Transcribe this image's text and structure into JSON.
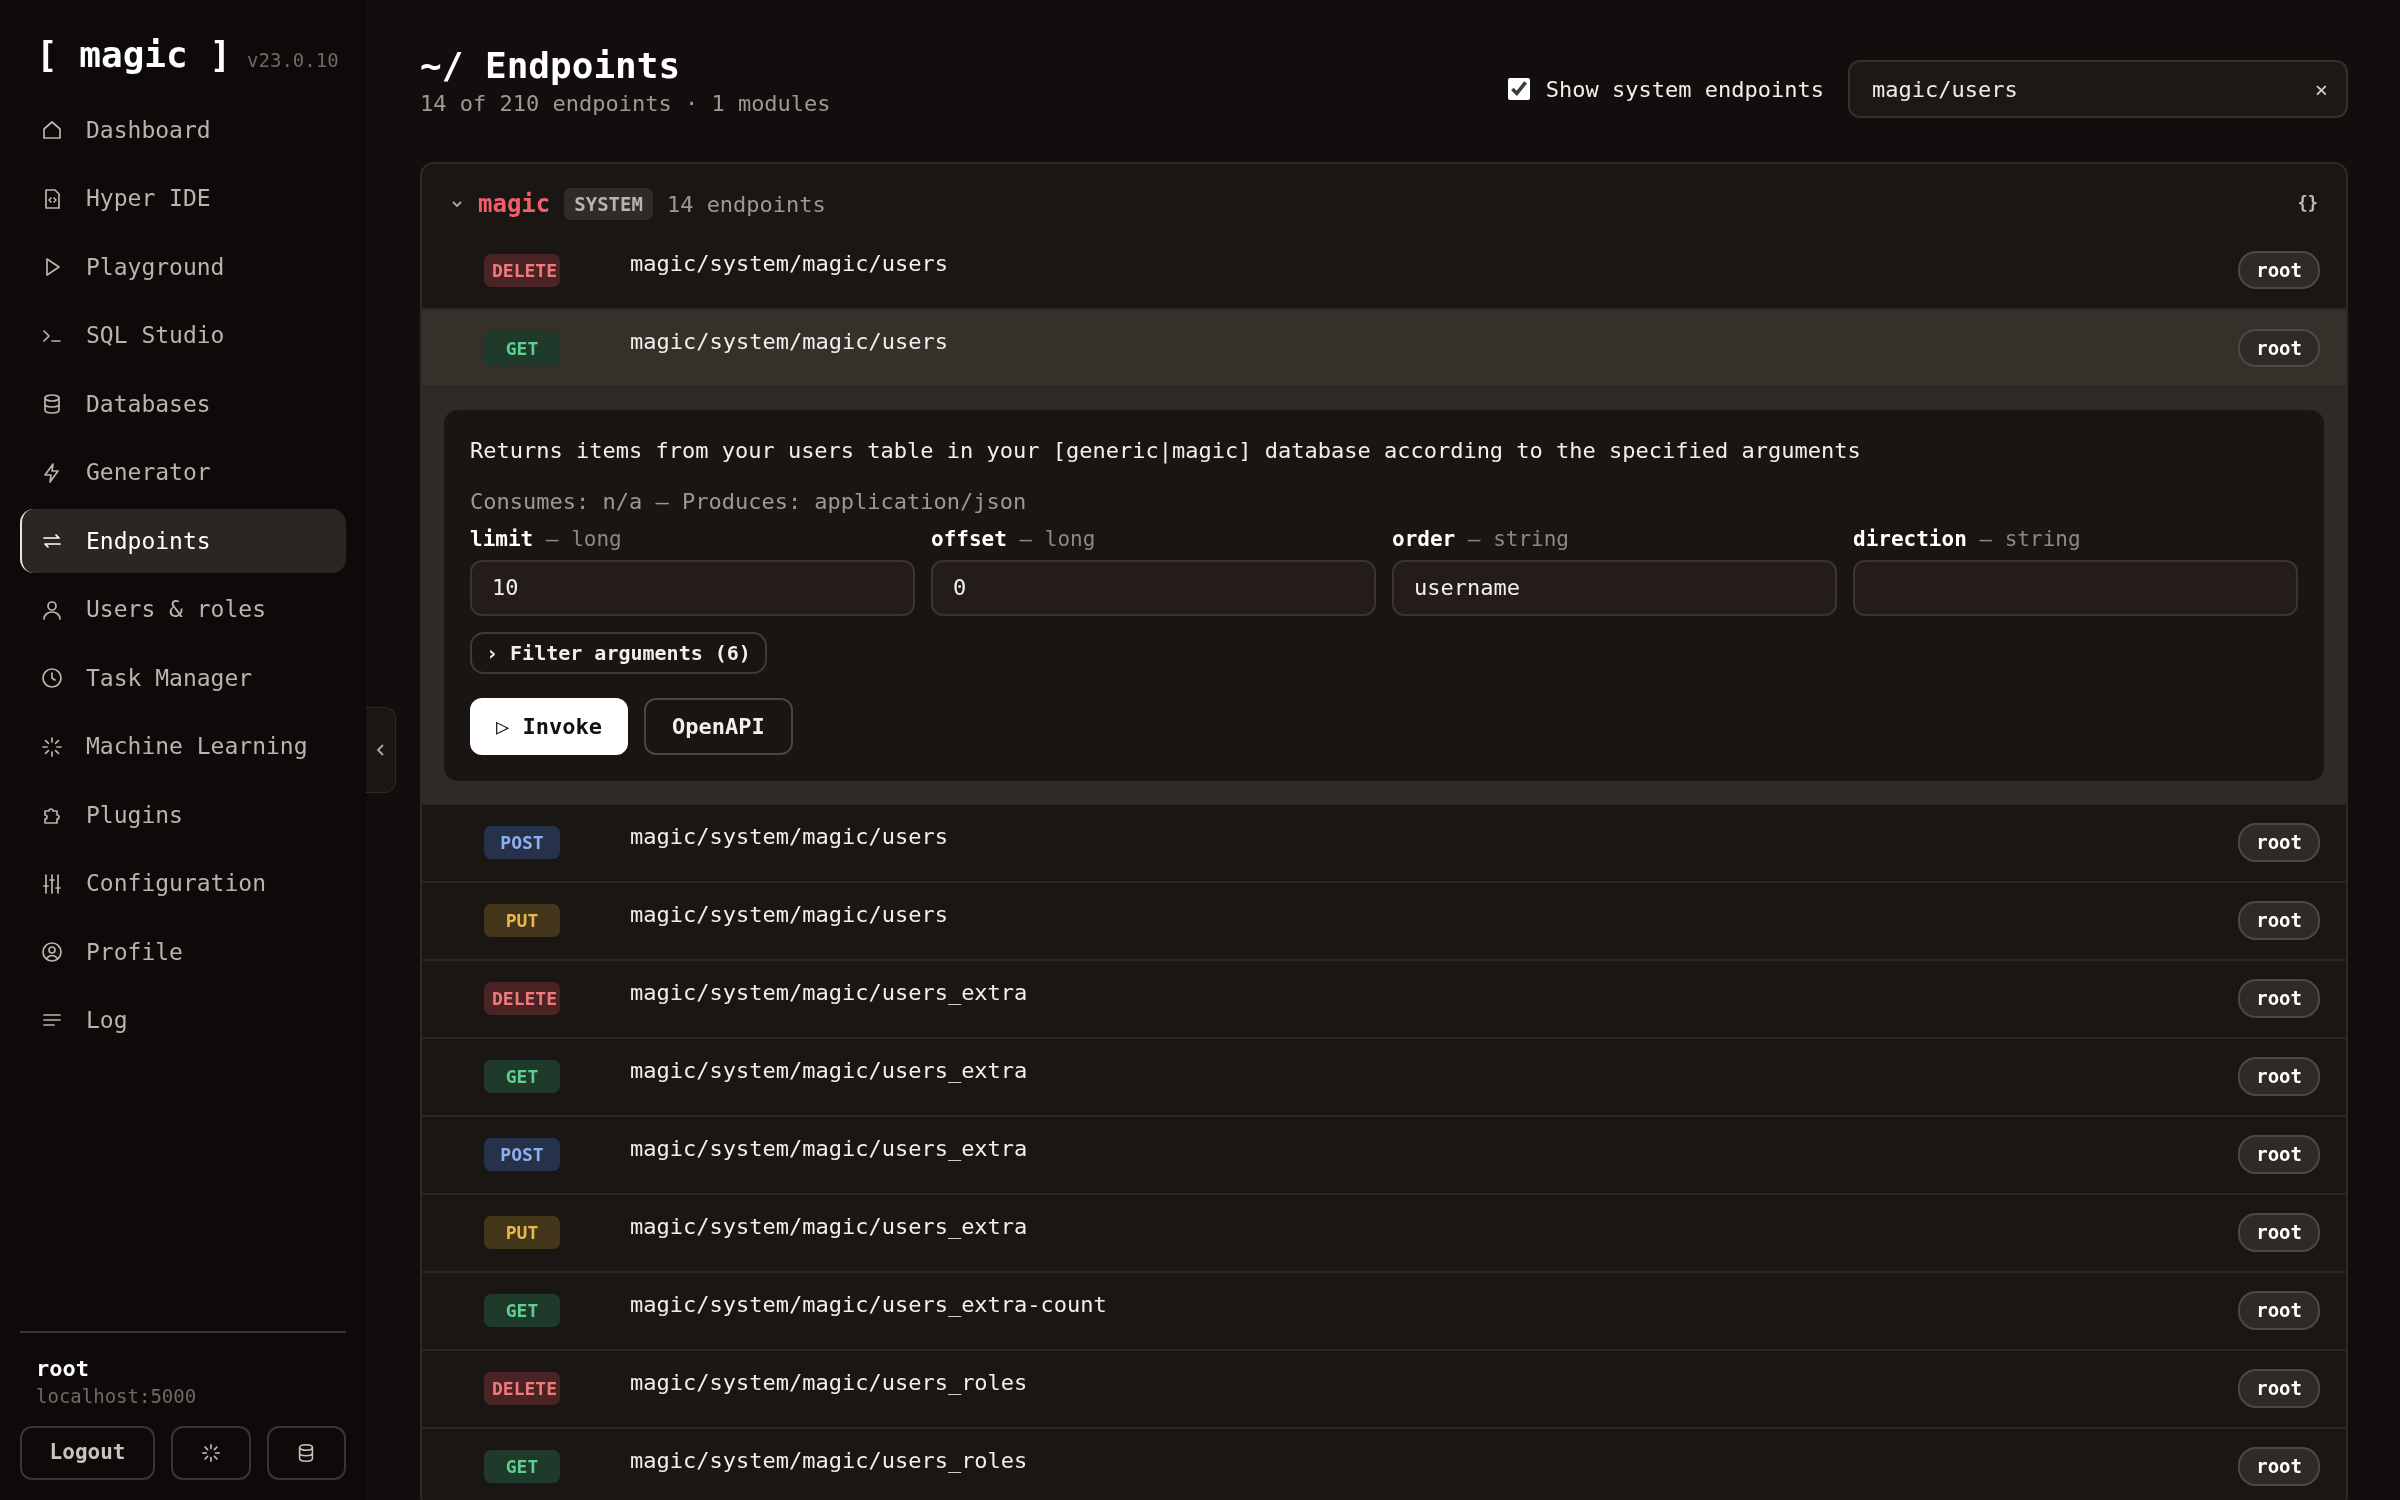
{
  "brand": {
    "logo": "[ magic ]",
    "version": "v23.0.10"
  },
  "sidebar": {
    "items": [
      {
        "label": "Dashboard",
        "selected": false
      },
      {
        "label": "Hyper IDE",
        "selected": false
      },
      {
        "label": "Playground",
        "selected": false
      },
      {
        "label": "SQL Studio",
        "selected": false
      },
      {
        "label": "Databases",
        "selected": false
      },
      {
        "label": "Generator",
        "selected": false
      },
      {
        "label": "Endpoints",
        "selected": true
      },
      {
        "label": "Users & roles",
        "selected": false
      },
      {
        "label": "Task Manager",
        "selected": false
      },
      {
        "label": "Machine Learning",
        "selected": false
      },
      {
        "label": "Plugins",
        "selected": false
      },
      {
        "label": "Configuration",
        "selected": false
      },
      {
        "label": "Profile",
        "selected": false
      },
      {
        "label": "Log",
        "selected": false
      }
    ]
  },
  "user": {
    "name": "root",
    "host": "localhost:5000"
  },
  "footer_buttons": [
    {
      "kind": "text",
      "label": "Logout"
    },
    {
      "kind": "spinner"
    },
    {
      "kind": "database"
    }
  ],
  "page": {
    "title": "~/ Endpoints",
    "subtitle": "14 of 210 endpoints · 1 modules"
  },
  "filters": {
    "show_system": {
      "label": "Show system endpoints",
      "checked": true
    },
    "search": {
      "value": "magic/users",
      "clear": "×"
    }
  },
  "module": {
    "name": "magic",
    "badge": "SYSTEM",
    "count": "14 endpoints",
    "expanded": true,
    "schema_button": "{}",
    "endpoints": [
      {
        "method": "DELETE",
        "kind": "delete",
        "path": "magic/system/magic/users",
        "role": "root",
        "selected": false
      },
      {
        "method": "GET",
        "kind": "get",
        "path": "magic/system/magic/users",
        "role": "root",
        "selected": true,
        "details": {
          "description": "Returns items from your users table in your [generic|magic] database according to the specified arguments",
          "formats": "Consumes: n/a — Produces: application/json",
          "arguments": [
            {
              "name": "limit",
              "type": "— long",
              "value": "10"
            },
            {
              "name": "offset",
              "type": "— long",
              "value": "0"
            },
            {
              "name": "order",
              "type": "— string",
              "value": "username"
            },
            {
              "name": "direction",
              "type": "— string"
            }
          ],
          "filter_toggle": {
            "chevron": "›",
            "label": "Filter arguments (6)"
          },
          "buttons": [
            {
              "kind": "primary",
              "label": "▷ Invoke"
            },
            {
              "kind": "outline",
              "label": "OpenAPI"
            }
          ]
        }
      },
      {
        "method": "POST",
        "kind": "post",
        "path": "magic/system/magic/users",
        "role": "root",
        "selected": false
      },
      {
        "method": "PUT",
        "kind": "put",
        "path": "magic/system/magic/users",
        "role": "root",
        "selected": false
      },
      {
        "method": "DELETE",
        "kind": "delete",
        "path": "magic/system/magic/users_extra",
        "role": "root",
        "selected": false
      },
      {
        "method": "GET",
        "kind": "get",
        "path": "magic/system/magic/users_extra",
        "role": "root",
        "selected": false
      },
      {
        "method": "POST",
        "kind": "post",
        "path": "magic/system/magic/users_extra",
        "role": "root",
        "selected": false
      },
      {
        "method": "PUT",
        "kind": "put",
        "path": "magic/system/magic/users_extra",
        "role": "root",
        "selected": false
      },
      {
        "method": "GET",
        "kind": "get",
        "path": "magic/system/magic/users_extra-count",
        "role": "root",
        "selected": false
      },
      {
        "method": "DELETE",
        "kind": "delete",
        "path": "magic/system/magic/users_roles",
        "role": "root",
        "selected": false
      },
      {
        "method": "GET",
        "kind": "get",
        "path": "magic/system/magic/users_roles",
        "role": "root",
        "selected": false
      }
    ]
  }
}
